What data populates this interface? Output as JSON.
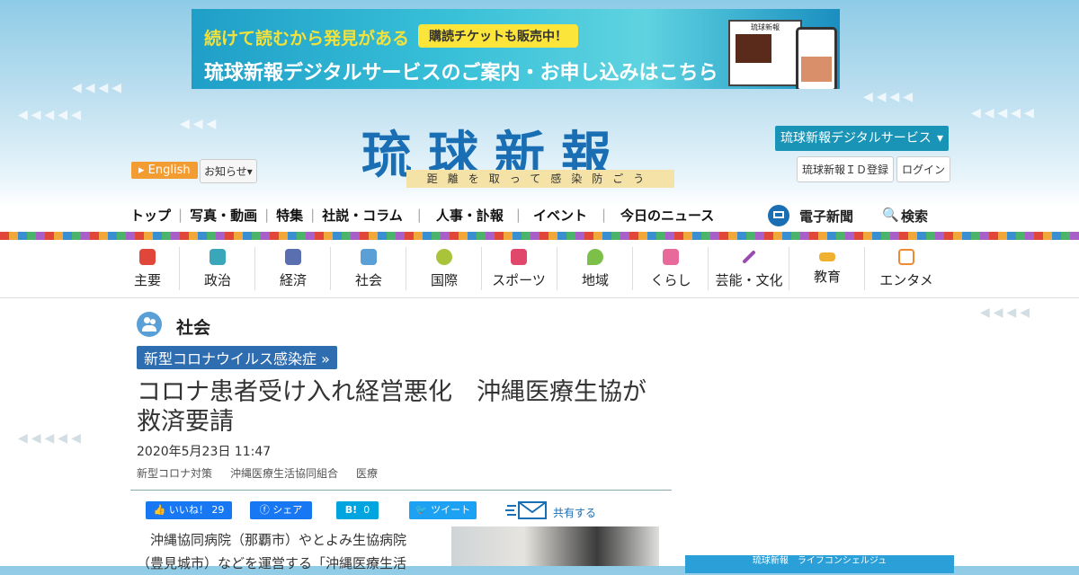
{
  "banner": {
    "line1": "続けて読むから発見がある",
    "pill": "購読チケットも販売中！",
    "line2": "琉球新報デジタルサービスのご案内・お申し込みはこちら",
    "screen_logo": "琉球新報"
  },
  "header": {
    "logo": "琉球新報",
    "slogan": "距離を取って感染防ごう",
    "english": "English",
    "notice": "お知らせ",
    "digital_service": "琉球新報デジタルサービス",
    "id_register": "琉球新報ＩＤ登録",
    "login": "ログイン"
  },
  "main_nav": [
    {
      "label": "トップ"
    },
    {
      "label": "写真・動画"
    },
    {
      "label": "特集"
    },
    {
      "label": "社説・コラム"
    },
    {
      "label": "人事・訃報"
    },
    {
      "label": "イベント"
    },
    {
      "label": "今日のニュース"
    }
  ],
  "extra_nav": {
    "edenshi": "電子新聞",
    "search": "検索"
  },
  "categories": [
    {
      "label": "主要",
      "icon": "flag-icon",
      "color": "#e0473a"
    },
    {
      "label": "政治",
      "icon": "parliament-icon",
      "color": "#3aa6b9"
    },
    {
      "label": "経済",
      "icon": "chart-icon",
      "color": "#5a6fb0"
    },
    {
      "label": "社会",
      "icon": "people-icon",
      "color": "#5a9fd6"
    },
    {
      "label": "国際",
      "icon": "globe-icon",
      "color": "#a9c43a"
    },
    {
      "label": "スポーツ",
      "icon": "runner-icon",
      "color": "#e0476a"
    },
    {
      "label": "地域",
      "icon": "pin-icon",
      "color": "#7cc04a"
    },
    {
      "label": "くらし",
      "icon": "house-icon",
      "color": "#e86a9a"
    },
    {
      "label": "芸能・文化",
      "icon": "sanshin-icon",
      "color": "#9a4ab0"
    },
    {
      "label": "教育",
      "icon": "graduation-cap-icon",
      "color": "#f0b030"
    },
    {
      "label": "エンタメ",
      "icon": "tv-icon",
      "color": "#f08a30"
    }
  ],
  "article": {
    "section": "社会",
    "topic_tag": "新型コロナウイルス感染症 »",
    "headline": "コロナ患者受け入れ経営悪化　沖縄医療生協が救済要請",
    "date": "2020年5月23日 11:47",
    "tags": [
      "新型コロナ対策",
      "沖縄医療生活協同組合",
      "医療"
    ],
    "body": "沖縄協同病院（那覇市）やとよみ生協病院（豊見城市）などを運営する「沖縄医療生活"
  },
  "share": {
    "like": "いいね！",
    "like_count": "29",
    "facebook_share": "シェア",
    "hatena": "B!",
    "hatena_count": "0",
    "tweet": "ツイート",
    "share_label": "共有する"
  },
  "ad": {
    "text": "琉球新報　ライフコンシェルジュ"
  }
}
